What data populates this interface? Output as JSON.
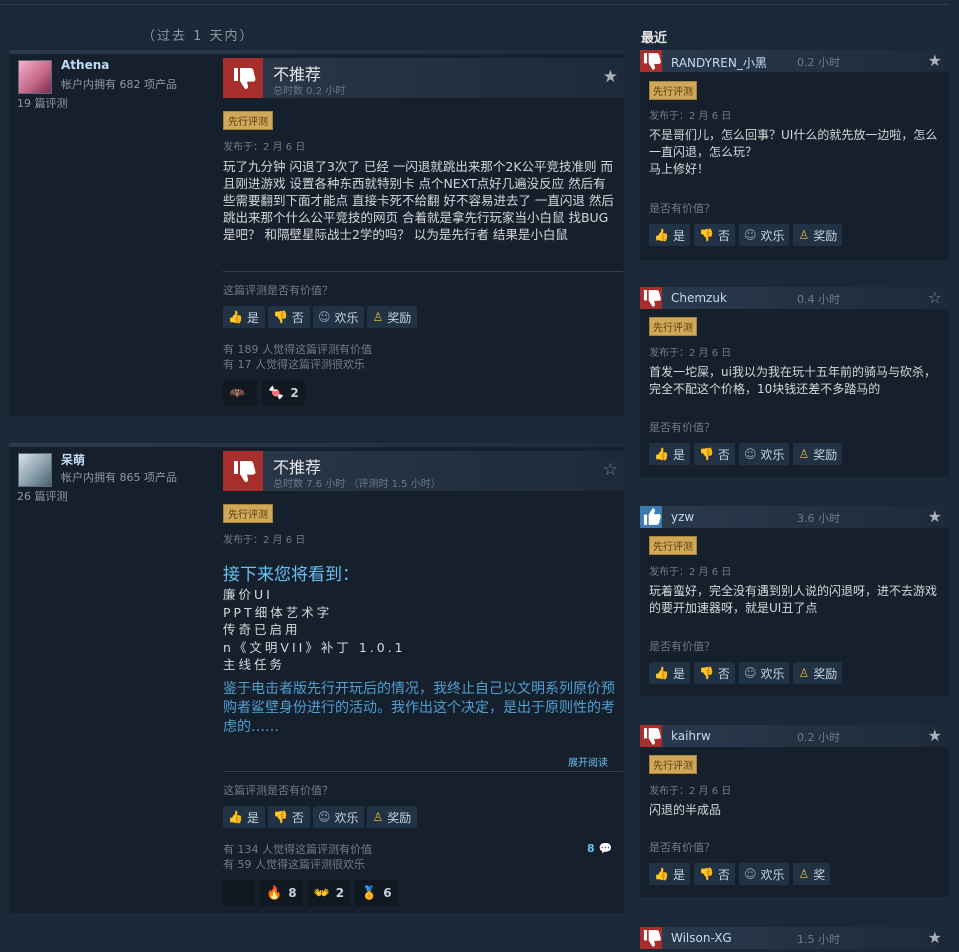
{
  "heading_past": "（过去 1 天内）",
  "heading_recent": "最近",
  "reviews": [
    {
      "author": "Athena",
      "products": "帐户内拥有 682 项产品",
      "review_count": "19 篇评测",
      "verdict": "不推荐",
      "hours": "总时数 0.2 小时",
      "badge": "先行评测",
      "posted": "发布于：2 月 6 日",
      "body": "玩了九分钟 闪退了3次了 已经 一闪退就跳出来那个2K公平竞技准则 而且刚进游戏 设置各种东西就特别卡 点个NEXT点好几遍没反应 然后有些需要翻到下面才能点 直接卡死不给翻 好不容易进去了 一直闪退 然后跳出来那个什么公平竞技的网页 合着就是拿先行玩家当小白鼠 找BUG是吧？ 和隔壁星际战士2学的吗？ 以为是先行者 结果是小白鼠",
      "helpful_question": "这篇评测是否有价值？",
      "btn_yes": "是",
      "btn_no": "否",
      "btn_funny": "欢乐",
      "btn_award": "奖励",
      "helpful_count": "有 189 人觉得这篇评测有价值",
      "funny_count": "有 17 人觉得这篇评测很欢乐",
      "reactions": [
        {
          "emoji": "🦇",
          "count": ""
        },
        {
          "emoji": "🍬",
          "count": "2"
        }
      ]
    },
    {
      "author": "呆萌",
      "products": "帐户内拥有 865 项产品",
      "review_count": "26 篇评测",
      "verdict": "不推荐",
      "hours": "总时数 7.6 小时 （评测时 1.5 小时）",
      "badge": "先行评测",
      "posted": "发布于：2 月 6 日",
      "spoiler_heading": "接下来您将看到：",
      "list": [
        "廉价UI",
        "PPT细体艺术字",
        "传奇已启用",
        "n《文明VII》补丁 1.0.1",
        "主线任务"
      ],
      "blue_paragraph": "鉴于电击者版先行开玩后的情况，我终止自己以文明系列原价预购者鲨壁身份进行的活动。我作出这个决定，是出于原则性的考虑的……",
      "expand": "展开阅读",
      "helpful_question": "这篇评测是否有价值？",
      "btn_yes": "是",
      "btn_no": "否",
      "btn_funny": "欢乐",
      "btn_award": "奖励",
      "helpful_count": "有 134 人觉得这篇评测有价值",
      "funny_count": "有 59 人觉得这篇评测很欢乐",
      "comments": "8",
      "reactions": [
        {
          "emoji": "",
          "count": ""
        },
        {
          "emoji": "🔥",
          "count": "8"
        },
        {
          "emoji": "👐",
          "count": "2"
        },
        {
          "emoji": "🏅",
          "count": "6"
        }
      ]
    }
  ],
  "recent": [
    {
      "name": "RANDYREN_小黑",
      "hours": "0.2 小时",
      "thumb": "down",
      "star": "filled",
      "badge": "先行评测",
      "posted": "发布于：2 月 6 日",
      "text": "不是哥们儿，怎么回事？UI什么的就先放一边啦，怎么一直闪退，怎么玩？\n马上修好！",
      "question": "是否有价值？",
      "yes": "是",
      "no": "否",
      "funny": "欢乐",
      "award": "奖励"
    },
    {
      "name": "Chemzuk",
      "hours": "0.4 小时",
      "thumb": "down",
      "star": "hollow",
      "badge": "先行评测",
      "posted": "发布于：2 月 6 日",
      "text": "首发一坨屎，ui我以为我在玩十五年前的骑马与砍杀，完全不配这个价格，10块钱还差不多踏马的",
      "question": "是否有价值？",
      "yes": "是",
      "no": "否",
      "funny": "欢乐",
      "award": "奖励"
    },
    {
      "name": "yzw",
      "hours": "3.6 小时",
      "thumb": "up",
      "star": "filled",
      "badge": "先行评测",
      "posted": "发布于：2 月 6 日",
      "text": "玩着蛮好，完全没有遇到别人说的闪退呀，进不去游戏的要开加速器呀，就是UI丑了点",
      "question": "是否有价值？",
      "yes": "是",
      "no": "否",
      "funny": "欢乐",
      "award": "奖励"
    },
    {
      "name": "kaihrw",
      "hours": "0.2 小时",
      "thumb": "down",
      "star": "filled",
      "badge": "先行评测",
      "posted": "发布于：2 月 6 日",
      "text": "闪退的半成品",
      "question": "是否有价值？",
      "yes": "是",
      "no": "否",
      "funny": "欢乐",
      "award": "奖"
    },
    {
      "name": "Wilson-XG",
      "hours": "1.5 小时",
      "thumb": "down",
      "star": "filled"
    }
  ]
}
